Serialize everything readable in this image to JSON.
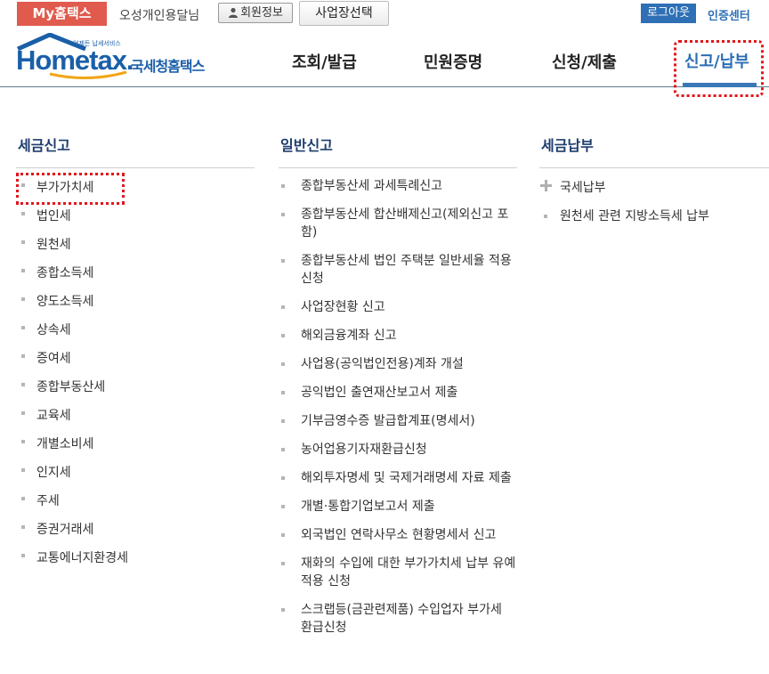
{
  "topbar": {
    "my_hometax": "My홈택스",
    "user_name": "오성개인용달님",
    "member_info": "회원정보",
    "select_business": "사업장선택",
    "logout": "로그아웃",
    "cert_center": "인증센터"
  },
  "logo": {
    "english": "Hometax.",
    "korean": "국세청홈택스",
    "tagline": "언제든 납세서비스"
  },
  "nav": {
    "items": [
      "조회/발급",
      "민원증명",
      "신청/제출",
      "신고/납부"
    ],
    "active": "신고/납부"
  },
  "columns": [
    {
      "title": "세금신고",
      "items": [
        "부가가치세",
        "법인세",
        "원천세",
        "종합소득세",
        "양도소득세",
        "상속세",
        "증여세",
        "종합부동산세",
        "교육세",
        "개별소비세",
        "인지세",
        "주세",
        "증권거래세",
        "교통에너지환경세"
      ]
    },
    {
      "title": "일반신고",
      "items": [
        "종합부동산세 과세특례신고",
        "종합부동산세 합산배제신고(제외신고 포함)",
        "종합부동산세 법인 주택분 일반세율 적용 신청",
        "사업장현황 신고",
        "해외금융계좌 신고",
        "사업용(공익법인전용)계좌 개설",
        "공익법인 출연재산보고서 제출",
        "기부금영수증 발급합계표(명세서)",
        "농어업용기자재환급신청",
        "해외투자명세 및 국제거래명세 자료 제출",
        "개별·통합기업보고서 제출",
        "외국법인 연락사무소 현황명세서 신고",
        "재화의 수입에 대한 부가가치세 납부 유예 적용 신청",
        "스크랩등(금관련제품) 수입업자 부가세 환급신청"
      ]
    },
    {
      "title": "세금납부",
      "items": [
        "국세납부",
        "원천세 관련 지방소득세 납부"
      ]
    }
  ],
  "colors": {
    "accent": "#2a6eb5",
    "my_hometax_bg": "#e05a4e",
    "highlight": "#e0161b",
    "column_title": "#1d3c6d"
  }
}
